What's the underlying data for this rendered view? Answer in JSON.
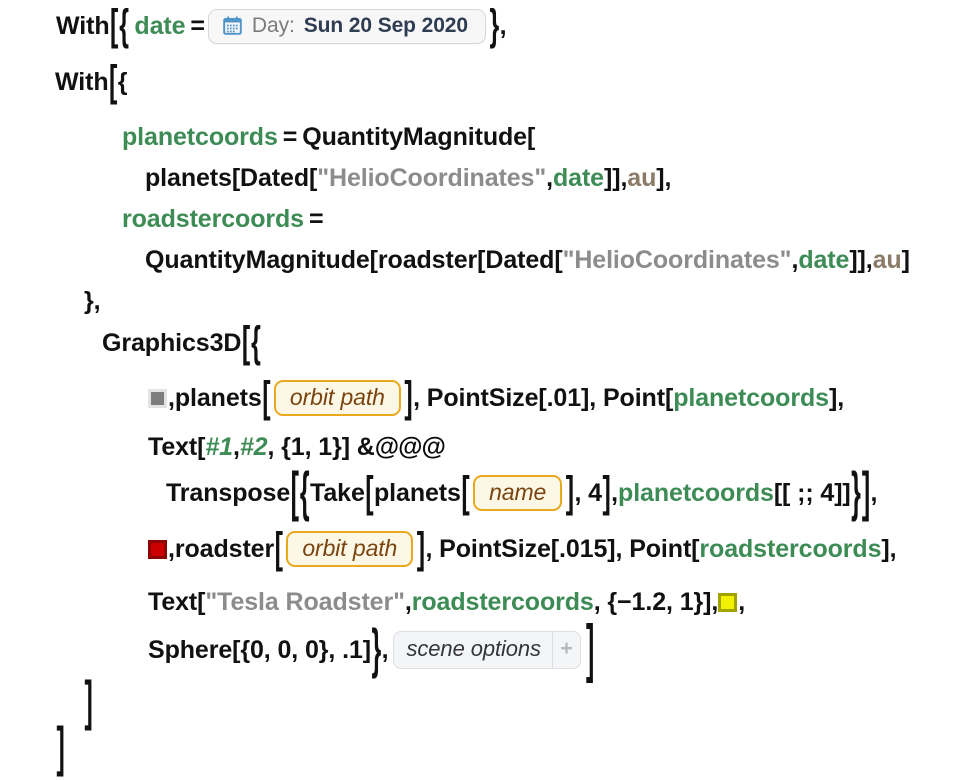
{
  "cell": {
    "language": "Wolfram Language",
    "type": "input-cell",
    "background": "#ffffff"
  },
  "colors": {
    "default_token": "#111111",
    "local_symbol": "#3d8b55",
    "string": "#8c8c8c",
    "unit": "#8a7a66",
    "entity_border": "#eaa81f",
    "entity_background": "#fdf8e6",
    "entity_text": "#7a4410",
    "swatch_gray": "#7d7d7d",
    "swatch_red": "#cc0000",
    "swatch_yellow": "#f2f200",
    "calendar_icon": "#4f95c8"
  },
  "datepicker": {
    "icon": "calendar-icon",
    "label": "Day:",
    "value": "Sun 20 Sep 2020"
  },
  "entities": {
    "orbit_path_1": "orbit path",
    "name": "name",
    "orbit_path_2": "orbit path"
  },
  "scene_options": {
    "label": "scene options",
    "add_button": "+"
  },
  "code": {
    "line1": {
      "with": "With",
      "open_bracket": "[",
      "open_brace": "{",
      "symbol": "date",
      "equals": "=",
      "close_brace": "}",
      "comma": ","
    },
    "line2": {
      "with": "With",
      "open_bracket": "[",
      "open_brace": "{"
    },
    "line3": {
      "symbol": "planetcoords",
      "equals": "=",
      "fn": "QuantityMagnitude",
      "open_bracket": "["
    },
    "line4": {
      "pre": "planets[Dated[",
      "string": "\"HelioCoordinates\"",
      "comma1": ", ",
      "symbol": "date",
      "mid": "]], ",
      "unit": "au",
      "post": "],"
    },
    "line5": {
      "symbol": "roadstercoords",
      "equals": "="
    },
    "line6": {
      "pre": "QuantityMagnitude[roadster[Dated[",
      "string": "\"HelioCoordinates\"",
      "comma1": ", ",
      "symbol": "date",
      "mid": "]], ",
      "unit": "au",
      "post": "]"
    },
    "line7": {
      "close_brace": "}",
      "comma": ","
    },
    "line8": {
      "fn": "Graphics3D",
      "open_bracket": "[",
      "open_brace": "{"
    },
    "line9": {
      "swatch": "gray-color-swatch",
      "comma1": ", ",
      "fn": "planets",
      "open_bracket": "[",
      "entity": "orbit path",
      "close_bracket": "]",
      "mid": ", PointSize[.01], Point[",
      "symbol": "planetcoords",
      "post": "],"
    },
    "line10": {
      "fn": "Text[",
      "slot1": "#1",
      "comma1": ", ",
      "slot2": "#2",
      "args": ", {1, 1}] & ",
      "apply": "@@@"
    },
    "line11": {
      "fn": "Transpose",
      "open_bracket": "[",
      "open_brace": "{",
      "take": "Take",
      "take_bracket": "[",
      "planets": "planets",
      "planets_bracket": "[",
      "entity": "name",
      "close1": "]",
      "count": ", 4",
      "close2": "]",
      "comma": ", ",
      "symbol": "planetcoords",
      "part": "[[ ;; 4]]",
      "close_brace": "}",
      "close_bracket": "]",
      "comma_end": ","
    },
    "line12": {
      "swatch": "red-color-swatch",
      "comma1": ", ",
      "fn": "roadster",
      "open_bracket": "[",
      "entity": "orbit path",
      "close_bracket": "]",
      "mid": ", PointSize[.015], Point[",
      "symbol": "roadstercoords",
      "post": "],"
    },
    "line13": {
      "fn": "Text[",
      "string": "\"Tesla Roadster\"",
      "comma1": ", ",
      "symbol": "roadstercoords",
      "args": ", {−1.2, 1}], ",
      "swatch": "yellow-color-swatch",
      "post": ","
    },
    "line14": {
      "fn": "Sphere[{0, 0, 0}, .1]",
      "close_brace": "}",
      "comma": ", ",
      "close_bracket": "]"
    },
    "line15": {
      "close_bracket": "]"
    },
    "line16": {
      "close_bracket": "]"
    }
  }
}
